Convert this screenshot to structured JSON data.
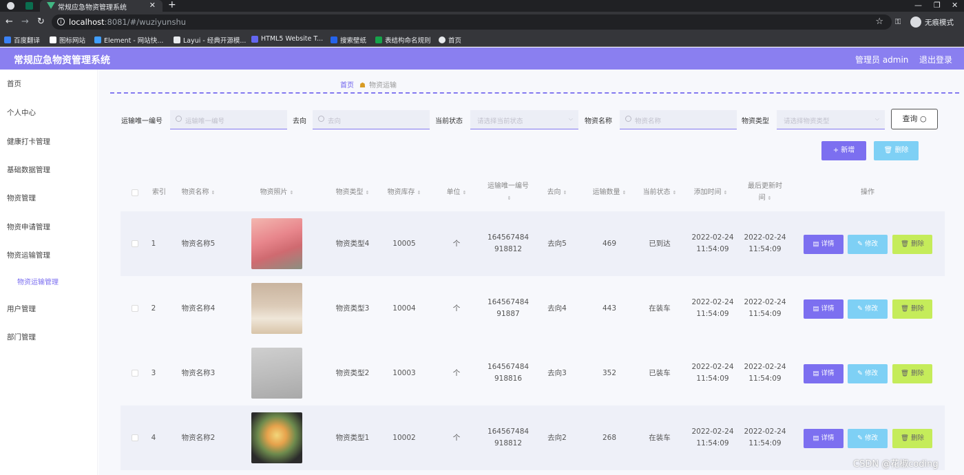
{
  "browser": {
    "tab_title": "常规应急物资管理系统",
    "url_host": "localhost",
    "url_path": ":8081/#/wuziyunshu",
    "incognito_label": "无痕模式",
    "bookmarks": [
      {
        "label": "百度翻译",
        "color": "#3b82f6"
      },
      {
        "label": "图标网站",
        "color": "#ffffff"
      },
      {
        "label": "Element - 网站快...",
        "color": "#409eff"
      },
      {
        "label": "Layui - 经典开源模...",
        "color": "#e8eaed"
      },
      {
        "label": "HTML5 Website T...",
        "color": "#6366f1"
      },
      {
        "label": "搜索壁纸",
        "color": "#2563eb"
      },
      {
        "label": "表结构命名规则",
        "color": "#16a34a"
      },
      {
        "label": "首页",
        "color": "#e8eaed"
      }
    ]
  },
  "header": {
    "title": "常规应急物资管理系统",
    "user": "管理员 admin",
    "logout": "退出登录"
  },
  "sidebar": {
    "items": [
      "首页",
      "个人中心",
      "健康打卡管理",
      "基础数据管理",
      "物资管理",
      "物资申请管理",
      "物资运输管理"
    ],
    "sub_item": "物资运输管理",
    "items_after": [
      "用户管理",
      "部门管理"
    ]
  },
  "breadcrumb": {
    "home": "首页",
    "current": "物资运输"
  },
  "search": {
    "fields": [
      {
        "label": "运输唯一编号",
        "placeholder": "运输唯一编号"
      },
      {
        "label": "去向",
        "placeholder": "去向"
      },
      {
        "label": "当前状态",
        "placeholder": "请选择当前状态"
      },
      {
        "label": "物资名称",
        "placeholder": "物资名称"
      },
      {
        "label": "物资类型",
        "placeholder": "请选择物资类型"
      }
    ],
    "query_button": "查询"
  },
  "actions": {
    "add": "+ 新增",
    "delete": "删除"
  },
  "table": {
    "columns": [
      "索引",
      "物资名称",
      "物资照片",
      "物资类型",
      "物资库存",
      "单位",
      "运输唯一编号",
      "去向",
      "运输数量",
      "当前状态",
      "添加时间",
      "最后更新时间",
      "操作"
    ],
    "rows": [
      {
        "index": "1",
        "name": "物资名称5",
        "photo": "pink-flowers",
        "type": "物资类型4",
        "stock": "10005",
        "unit": "个",
        "code1": "164567484",
        "code2": "918812",
        "dest": "去向5",
        "qty": "469",
        "status": "已到达",
        "added_date": "2022-02-24",
        "added_time": "11:54:09",
        "updated_date": "2022-02-24",
        "updated_time": "11:54:09"
      },
      {
        "index": "2",
        "name": "物资名称4",
        "photo": "pen-holder",
        "type": "物资类型3",
        "stock": "10004",
        "unit": "个",
        "code1": "164567484",
        "code2": "91887",
        "dest": "去向4",
        "qty": "443",
        "status": "在装车",
        "added_date": "2022-02-24",
        "added_time": "11:54:09",
        "updated_date": "2022-02-24",
        "updated_time": "11:54:09"
      },
      {
        "index": "3",
        "name": "物资名称3",
        "photo": "hand-tool",
        "type": "物资类型2",
        "stock": "10003",
        "unit": "个",
        "code1": "164567484",
        "code2": "918816",
        "dest": "去向3",
        "qty": "352",
        "status": "已装车",
        "added_date": "2022-02-24",
        "added_time": "11:54:09",
        "updated_date": "2022-02-24",
        "updated_time": "11:54:09"
      },
      {
        "index": "4",
        "name": "物资名称2",
        "photo": "bouquet",
        "type": "物资类型1",
        "stock": "10002",
        "unit": "个",
        "code1": "164567484",
        "code2": "918812",
        "dest": "去向2",
        "qty": "268",
        "status": "在装车",
        "added_date": "2022-02-24",
        "added_time": "11:54:09",
        "updated_date": "2022-02-24",
        "updated_time": "11:54:09"
      }
    ],
    "row_buttons": {
      "detail": "详情",
      "edit": "修改",
      "delete": "删除"
    }
  },
  "watermark": "CSDN @花椒coding",
  "colors": {
    "accent": "#8a7ff0",
    "detail": "#7c6ff0",
    "edit": "#7ed0f5",
    "delete": "#c5ec5a"
  }
}
